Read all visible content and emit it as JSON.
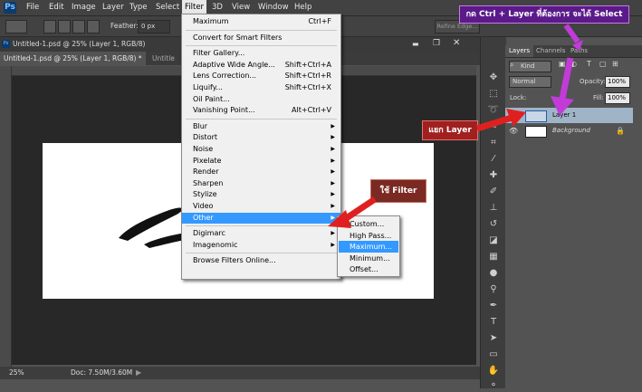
{
  "app": {
    "logo": "Ps"
  },
  "menubar": {
    "items": [
      "File",
      "Edit",
      "Image",
      "Layer",
      "Type",
      "Select",
      "Filter",
      "3D",
      "View",
      "Window",
      "Help"
    ],
    "active": "Filter"
  },
  "options": {
    "feather_label": "Feather:",
    "feather_value": "0 px",
    "refine_edge": "Refine Edge..."
  },
  "document": {
    "title_row": "Untitled-1.psd @ 25% (Layer 1, RGB/8)",
    "tabs": [
      "Untitled-1.psd @ 25% (Layer 1, RGB/8) *",
      "Untitle"
    ]
  },
  "status": {
    "zoom": "25%",
    "doc_info": "Doc: 7.50M/3.60M"
  },
  "filter_menu": {
    "items": [
      {
        "label": "Maximum",
        "shortcut": "Ctrl+F"
      },
      {
        "sep": true
      },
      {
        "label": "Convert for Smart Filters"
      },
      {
        "sep": true
      },
      {
        "label": "Filter Gallery..."
      },
      {
        "label": "Adaptive Wide Angle...",
        "shortcut": "Shift+Ctrl+A"
      },
      {
        "label": "Lens Correction...",
        "shortcut": "Shift+Ctrl+R"
      },
      {
        "label": "Liquify...",
        "shortcut": "Shift+Ctrl+X"
      },
      {
        "label": "Oil Paint..."
      },
      {
        "label": "Vanishing Point...",
        "shortcut": "Alt+Ctrl+V"
      },
      {
        "sep": true
      },
      {
        "label": "Blur",
        "submenu": true
      },
      {
        "label": "Distort",
        "submenu": true
      },
      {
        "label": "Noise",
        "submenu": true
      },
      {
        "label": "Pixelate",
        "submenu": true
      },
      {
        "label": "Render",
        "submenu": true
      },
      {
        "label": "Sharpen",
        "submenu": true
      },
      {
        "label": "Stylize",
        "submenu": true
      },
      {
        "label": "Video",
        "submenu": true
      },
      {
        "label": "Other",
        "submenu": true,
        "highlighted": true
      },
      {
        "sep": true
      },
      {
        "label": "Digimarc",
        "submenu": true
      },
      {
        "label": "Imagenomic",
        "submenu": true
      },
      {
        "sep": true
      },
      {
        "label": "Browse Filters Online..."
      }
    ]
  },
  "other_submenu": {
    "items": [
      {
        "label": "Custom..."
      },
      {
        "label": "High Pass..."
      },
      {
        "label": "Maximum...",
        "highlighted": true
      },
      {
        "label": "Minimum..."
      },
      {
        "label": "Offset..."
      }
    ]
  },
  "layers_panel": {
    "tabs": [
      "Layers",
      "Channels",
      "Paths"
    ],
    "kind_label": "Kind",
    "blend_mode": "Normal",
    "opacity_label": "Opacity:",
    "opacity_value": "100%",
    "lock_label": "Lock:",
    "fill_label": "Fill:",
    "fill_value": "100%",
    "layers": [
      "Layer 1",
      "Background"
    ]
  },
  "annotations": {
    "top_note": "กด Ctrl + Layer ที่ต้องการ จะได้ Select",
    "layer_note": "แยก Layer",
    "filter_note": "ใช้  Filter"
  },
  "colors": {
    "highlight": "#3399ff",
    "note_purple": "#5b1a8a",
    "note_red": "#a02020",
    "note_maroon": "#7a2a22"
  }
}
